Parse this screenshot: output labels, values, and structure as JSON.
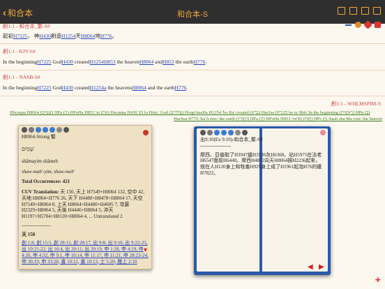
{
  "nav": {
    "back_label": "和合本",
    "title": "和合本-S"
  },
  "verses": [
    {
      "ref": "創1:1 - 和合本_繁-S#",
      "text_parts": [
        "起初",
        "H7225",
        "， 神",
        "H430",
        "創造",
        "H1254",
        "天",
        "H8064",
        "地",
        "H776",
        "。"
      ]
    },
    {
      "ref": "創1:1 - KJV-S#",
      "text_parts": [
        "In the beginning",
        "H7225",
        " God",
        "H430",
        " created",
        "H1254",
        "H853",
        " the heaven",
        "H8064",
        " and",
        "H853",
        " the earth",
        "H776",
        "."
      ]
    },
    {
      "ref": "創1:1 - NASB-S#",
      "text_parts": [
        "In the beginning",
        "H7225",
        " God",
        "H430",
        " created",
        "H1254a",
        " the heavens",
        "H8064",
        " and the earth",
        "H776",
        "."
      ]
    }
  ],
  "whlm": {
    "ref": "創1:1 - WHLMSPIM-S",
    "line1": "Hbcsnpa H8064 (שָּׁמַיִם) HPa (הַ) HPoHa H853 'et (אֵת) Hncmpa H430 'El lo Him;' God (אֱלֹהִים) Hvqp3msHa H1254 'bo Ra' created (בָּרָא) Hncfsa H7225 be re Shit/ In the beginning (רֵאשִׁית) HPp (בְּ)",
    "line2": "Hncbsa H776 /ha'A retz/ the earth (הָאָרֶץ) HPa (הָ) HPoHa H853 /ve'Et (וְאֵת) HPc (וְ) /hash sha Ma yim/ the heaven"
  },
  "strong_popup": {
    "header": "H8064-Strong 繁",
    "hebrew": "שָׁמַיִם",
    "translit": "shâmayim shâmeh",
    "pron": "shaw-mah'-yim, shaw-meh'",
    "occurrences_label": "Total Occurrences: 421",
    "cuv_label": "CUV Translation: ",
    "cuv_text": "天 150, 天上 H7549+H8064 132, 空中 42, 天地 H8064+H776 26, 天下 H4480+H8478+H8064 17, 天空 H7549+H8064 8, 上天 H8064+H4480+H4605 7, 穹蒼 H2329+H8064 5, 天後 H4446+H8064 5, 沖天 H1197+H5704+H8120+H8064 4, ... Untranslated 2",
    "dashes": "------------------",
    "count_label": "天 150",
    "refs": "創 1:8, 創 15:5, 創 28:12, 創 28:17, 出 9:8, 出 9:10, 出 9:22-23, 出 10:21-22, 出 16:4, 出 20:11, 出 20:19, 申 1:28, 申 4:19, 申 4:26, 申 4:32, 申 9:1, 申 10:14, 申 11:17, 申 11:21, 申 28:23-24, 申 30:19, 申 33:28, 書 10:11, 書 10:13, 士 5:20, 撒上 2:10"
  },
  "bible_popup": {
    "header": "出9:10(Ex 9:10)-和合本_繁-S#",
    "dashes": "-------------------",
    "text": "摩西、亞倫取了H3947爐H3536灰H6368，站H5975在法老H6547面前H6440。摩西H4872向天H8064揚H2236起來，就在人H120身上和牲畜H929身上成了H1961起泡H76的瘡H7822。"
  }
}
